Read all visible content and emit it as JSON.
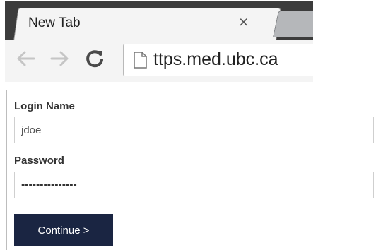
{
  "browser": {
    "tab_title": "New Tab",
    "tab_close_glyph": "×",
    "back_glyph": "⇐",
    "forward_glyph": "⇒",
    "reload_glyph": "C",
    "url": "ttps.med.ubc.ca",
    "icons": {
      "back": "back-arrow-icon",
      "forward": "forward-arrow-icon",
      "reload": "reload-icon",
      "page": "page-icon",
      "close": "close-icon"
    },
    "colors": {
      "chrome_dark": "#3c3c3c",
      "tab_bg": "#f4f4f4",
      "inactive_tab": "#b5b7ba"
    }
  },
  "login_form": {
    "login_name_label": "Login Name",
    "login_name_value": "jdoe",
    "password_label": "Password",
    "password_value": "•••••••••••••••",
    "continue_label": "Continue >",
    "colors": {
      "button_bg": "#1a2542",
      "button_text": "#ffffff"
    }
  }
}
